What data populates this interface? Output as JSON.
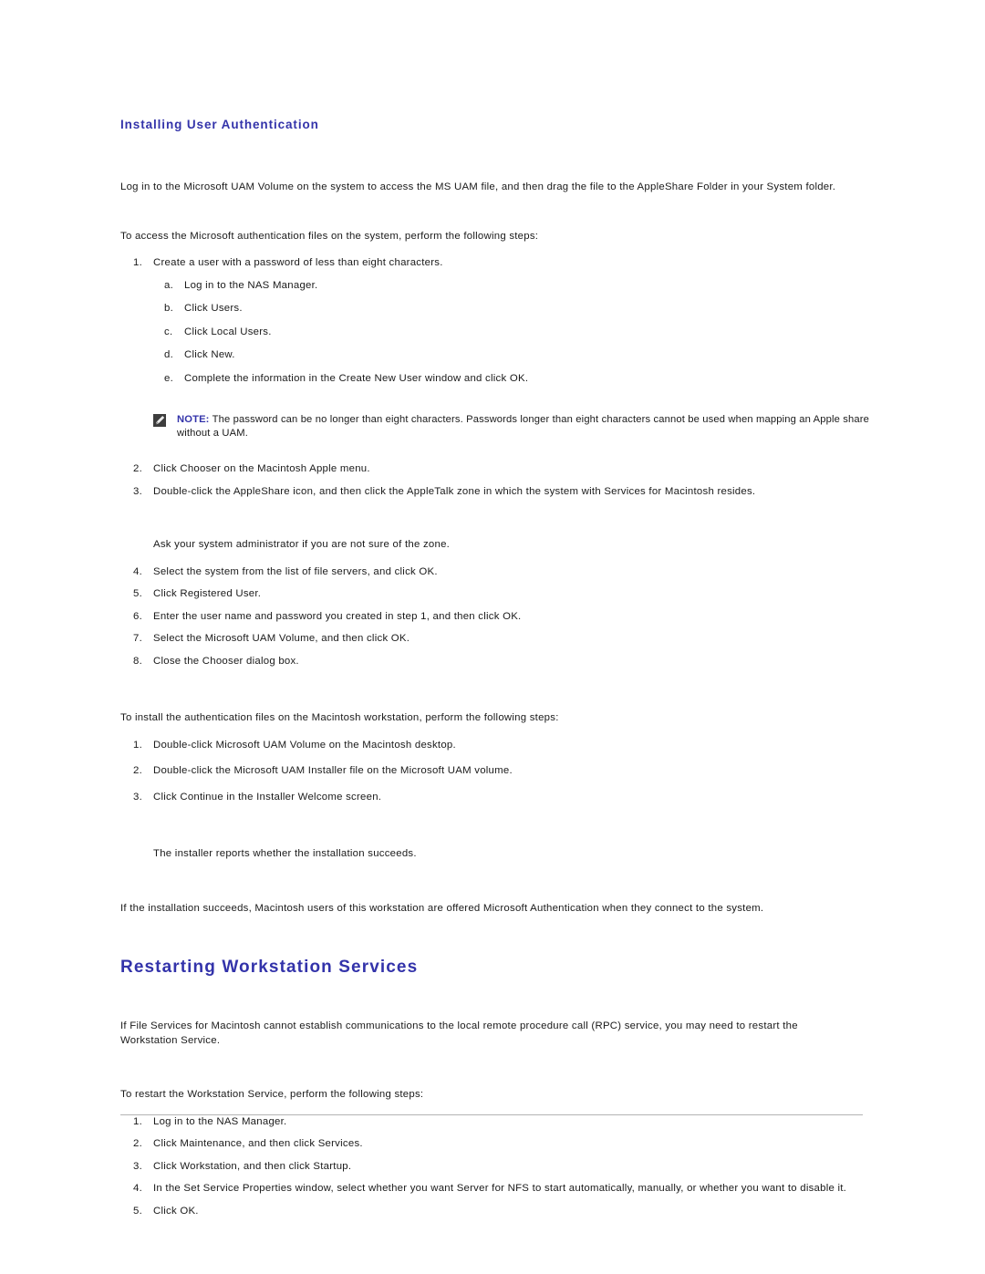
{
  "document": {
    "section1": {
      "heading": "Installing User Authentication",
      "intro": "Log in to the Microsoft UAM Volume on the system to access the MS UAM file, and then drag the file to the AppleShare Folder in your System folder.",
      "procedure1_lead": "To access the Microsoft authentication files on the system, perform the following steps:",
      "procedure1": [
        {
          "marker": "1.",
          "text": "Create a user with a password of less than eight characters.",
          "substeps": [
            {
              "marker": "a.",
              "text": "Log in to the NAS Manager."
            },
            {
              "marker": "b.",
              "text": "Click Users."
            },
            {
              "marker": "c.",
              "text": "Click Local Users."
            },
            {
              "marker": "d.",
              "text": "Click New."
            },
            {
              "marker": "e.",
              "text": "Complete the information in the Create New User window and click OK."
            }
          ]
        },
        {
          "marker": "2.",
          "text": "Click Chooser on the Macintosh Apple menu."
        },
        {
          "marker": "3.",
          "text": "Double-click the AppleShare icon, and then click the AppleTalk zone in which the system with Services for Macintosh resides."
        },
        {
          "marker": "4.",
          "text": "Select the system from the list of file servers, and click OK."
        },
        {
          "marker": "5.",
          "text": "Click Registered User."
        },
        {
          "marker": "6.",
          "text": "Enter the user name and password you created in step 1, and then click OK."
        },
        {
          "marker": "7.",
          "text": "Select the Microsoft UAM Volume, and then click OK."
        },
        {
          "marker": "8.",
          "text": "Close the Chooser dialog box."
        }
      ],
      "note": {
        "icon": "note-pencil-icon",
        "label": "NOTE:",
        "text": " The password can be no longer than eight characters. Passwords longer than eight characters cannot be used when mapping an Apple share without a UAM."
      },
      "zone_hint": "Ask your system administrator if you are not sure of the zone.",
      "procedure2_lead": "To install the authentication files on the Macintosh workstation, perform the following steps:",
      "procedure2": [
        {
          "marker": "1.",
          "text": "Double-click Microsoft UAM Volume on the Macintosh desktop."
        },
        {
          "marker": "2.",
          "text": "Double-click the Microsoft UAM Installer file on the Microsoft UAM volume."
        },
        {
          "marker": "3.",
          "text": "Click Continue in the Installer Welcome screen."
        }
      ],
      "installer_result": "The installer reports whether the installation succeeds.",
      "closing": "If the installation succeeds, Macintosh users of this workstation are offered Microsoft Authentication when they connect to the system."
    },
    "section2": {
      "heading": "Restarting Workstation Services",
      "intro": "If File Services for Macintosh cannot establish communications to the local remote procedure call (RPC) service, you may need to restart the Workstation Service.",
      "procedure_lead": "To restart the Workstation Service, perform the following steps:",
      "procedure": [
        {
          "marker": "1.",
          "text": "Log in to the NAS Manager."
        },
        {
          "marker": "2.",
          "text": "Click Maintenance, and then click Services."
        },
        {
          "marker": "3.",
          "text": "Click Workstation, and then click Startup."
        },
        {
          "marker": "4.",
          "text": "In the Set Service Properties window, select whether you want Server for NFS to start automatically, manually, or whether you want to disable it."
        },
        {
          "marker": "5.",
          "text": "Click OK."
        }
      ]
    }
  },
  "colors": {
    "heading": "#3333aa",
    "body": "#1a1a1a",
    "divider": "#b4b4b4",
    "note_icon_bg": "#3d3d3d"
  }
}
